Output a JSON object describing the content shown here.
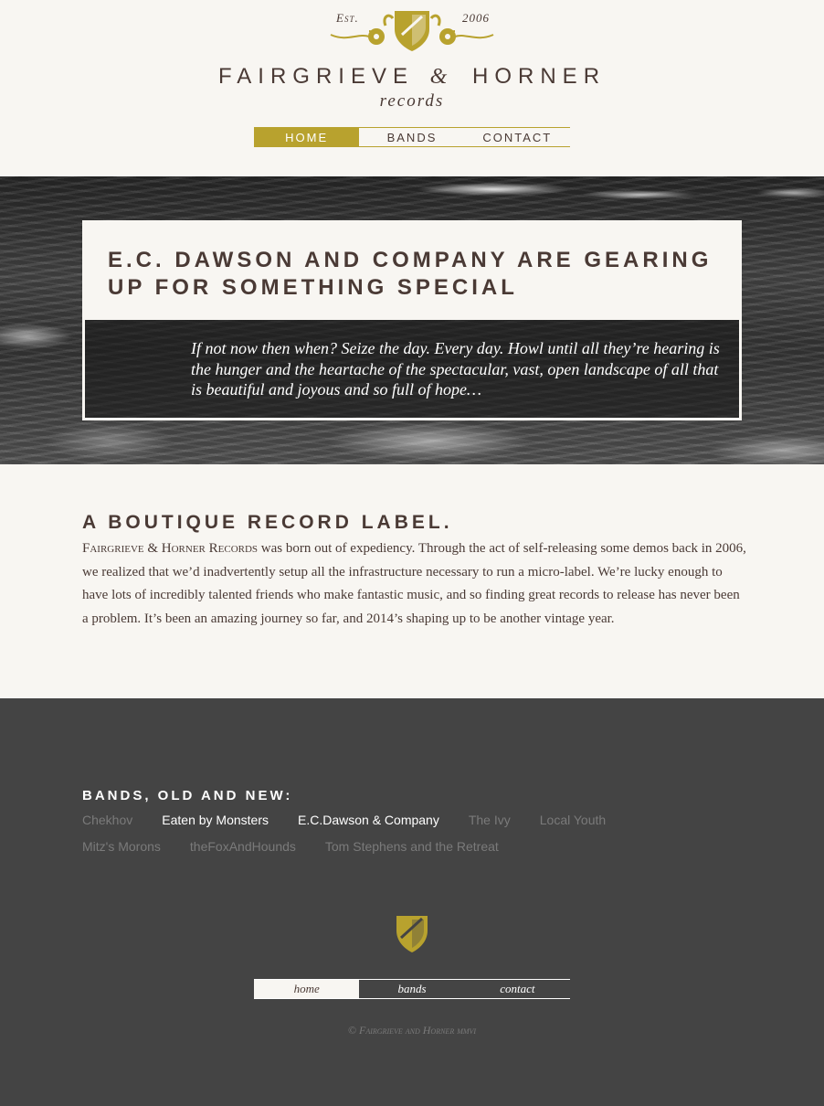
{
  "colors": {
    "accent": "#b8a22e",
    "text": "#4a3a35",
    "background": "#f8f6f2",
    "footer_bg": "#444444",
    "muted_link": "#7a7a7a"
  },
  "header": {
    "est_label": "Est.",
    "est_year": "2006",
    "crest_icon": "shield-crest-icon",
    "brand_left": "FAIRGRIEVE",
    "brand_amp": "&",
    "brand_right": "HORNER",
    "brand_sub": "records",
    "nav": [
      {
        "label": "HOME",
        "active": true
      },
      {
        "label": "BANDS",
        "active": false
      },
      {
        "label": "CONTACT",
        "active": false
      }
    ]
  },
  "hero": {
    "title": "E.C. Dawson and Company are gearing up for something special",
    "quote": "If not now then when? Seize the day. Every day. Howl until all they’re hearing is the hunger and the heartache of the spectacular, vast, open landscape of all that is beautiful and joyous and so full of hope…"
  },
  "about": {
    "heading": "A Boutique Record Label.",
    "lead": "Fairgrieve & Horner Records",
    "body": " was born out of expediency. Through the act of self-releasing some demos back in 2006, we realized that we’d inadvertently setup all the infrastructure necessary to run a micro-label. We’re lucky enough to have lots of incredibly talented friends who make fantastic music, and so finding great records to release has never been a problem. It’s been an amazing journey so far, and 2014’s shaping up to be another vintage year."
  },
  "footer": {
    "bands_heading": "Bands, old and new:",
    "bands": [
      {
        "name": "Chekhov",
        "highlight": false
      },
      {
        "name": "Eaten by Monsters",
        "highlight": true
      },
      {
        "name": "E.C.Dawson & Company",
        "highlight": true
      },
      {
        "name": "The Ivy",
        "highlight": false
      },
      {
        "name": "Local Youth",
        "highlight": false
      },
      {
        "name": "Mitz's Morons",
        "highlight": false
      },
      {
        "name": "theFoxAndHounds",
        "highlight": false
      },
      {
        "name": "Tom Stephens and the Retreat",
        "highlight": false
      }
    ],
    "crest_icon": "shield-icon",
    "nav": [
      {
        "label": "home",
        "active": true
      },
      {
        "label": "bands",
        "active": false
      },
      {
        "label": "contact",
        "active": false
      }
    ],
    "copyright": "© Fairgrieve and Horner mmvi"
  }
}
